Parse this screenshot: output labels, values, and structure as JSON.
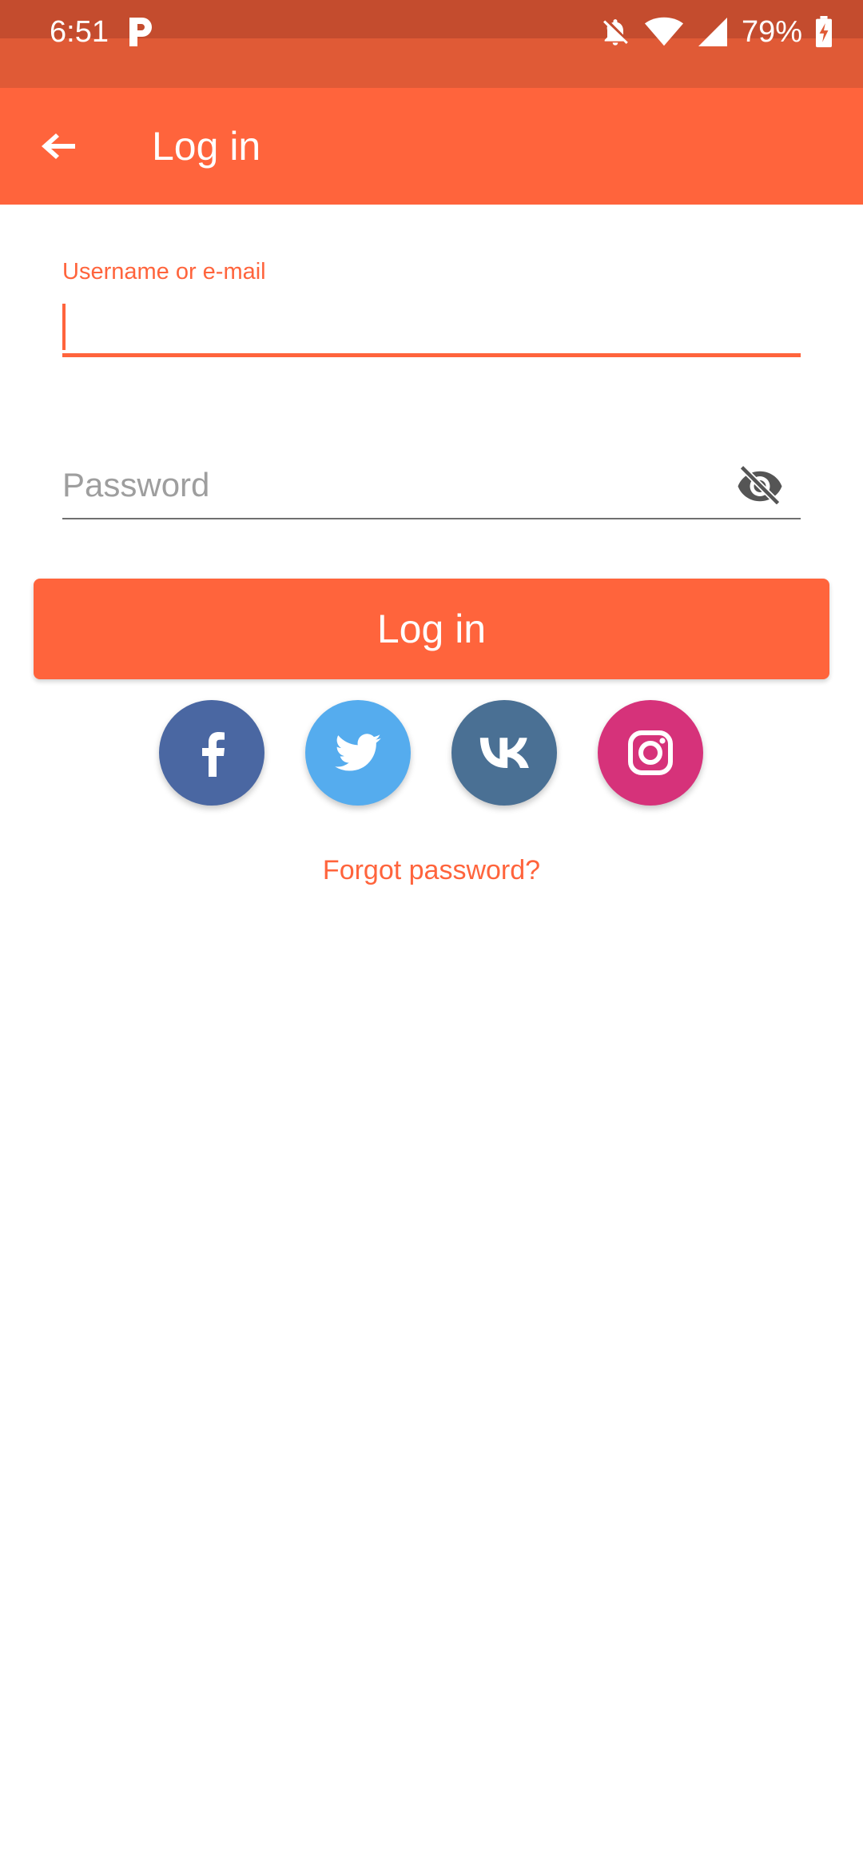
{
  "status_bar": {
    "time": "6:51",
    "battery": "79%",
    "icons": [
      "p-app-icon",
      "bell-off-icon",
      "wifi-icon",
      "signal-icon",
      "battery-charging-icon"
    ]
  },
  "app_bar": {
    "title": "Log in",
    "back_icon": "arrow-left-icon",
    "background": "#ff643c"
  },
  "form": {
    "username_label": "Username or e-mail",
    "username_value": "",
    "password_placeholder": "Password",
    "password_value": "",
    "visibility_icon": "eye-off-icon",
    "login_button_label": "Log in"
  },
  "social": [
    {
      "name": "Facebook",
      "icon": "facebook-icon",
      "color": "#4a67a2"
    },
    {
      "name": "Twitter",
      "icon": "twitter-icon",
      "color": "#55acee"
    },
    {
      "name": "VK",
      "icon": "vk-icon",
      "color": "#4a7094"
    },
    {
      "name": "Instagram",
      "icon": "instagram-icon",
      "color": "#d6327a"
    }
  ],
  "forgot_password": "Forgot password?",
  "colors": {
    "accent": "#ff643c",
    "status_bar": "#c44c2e"
  }
}
